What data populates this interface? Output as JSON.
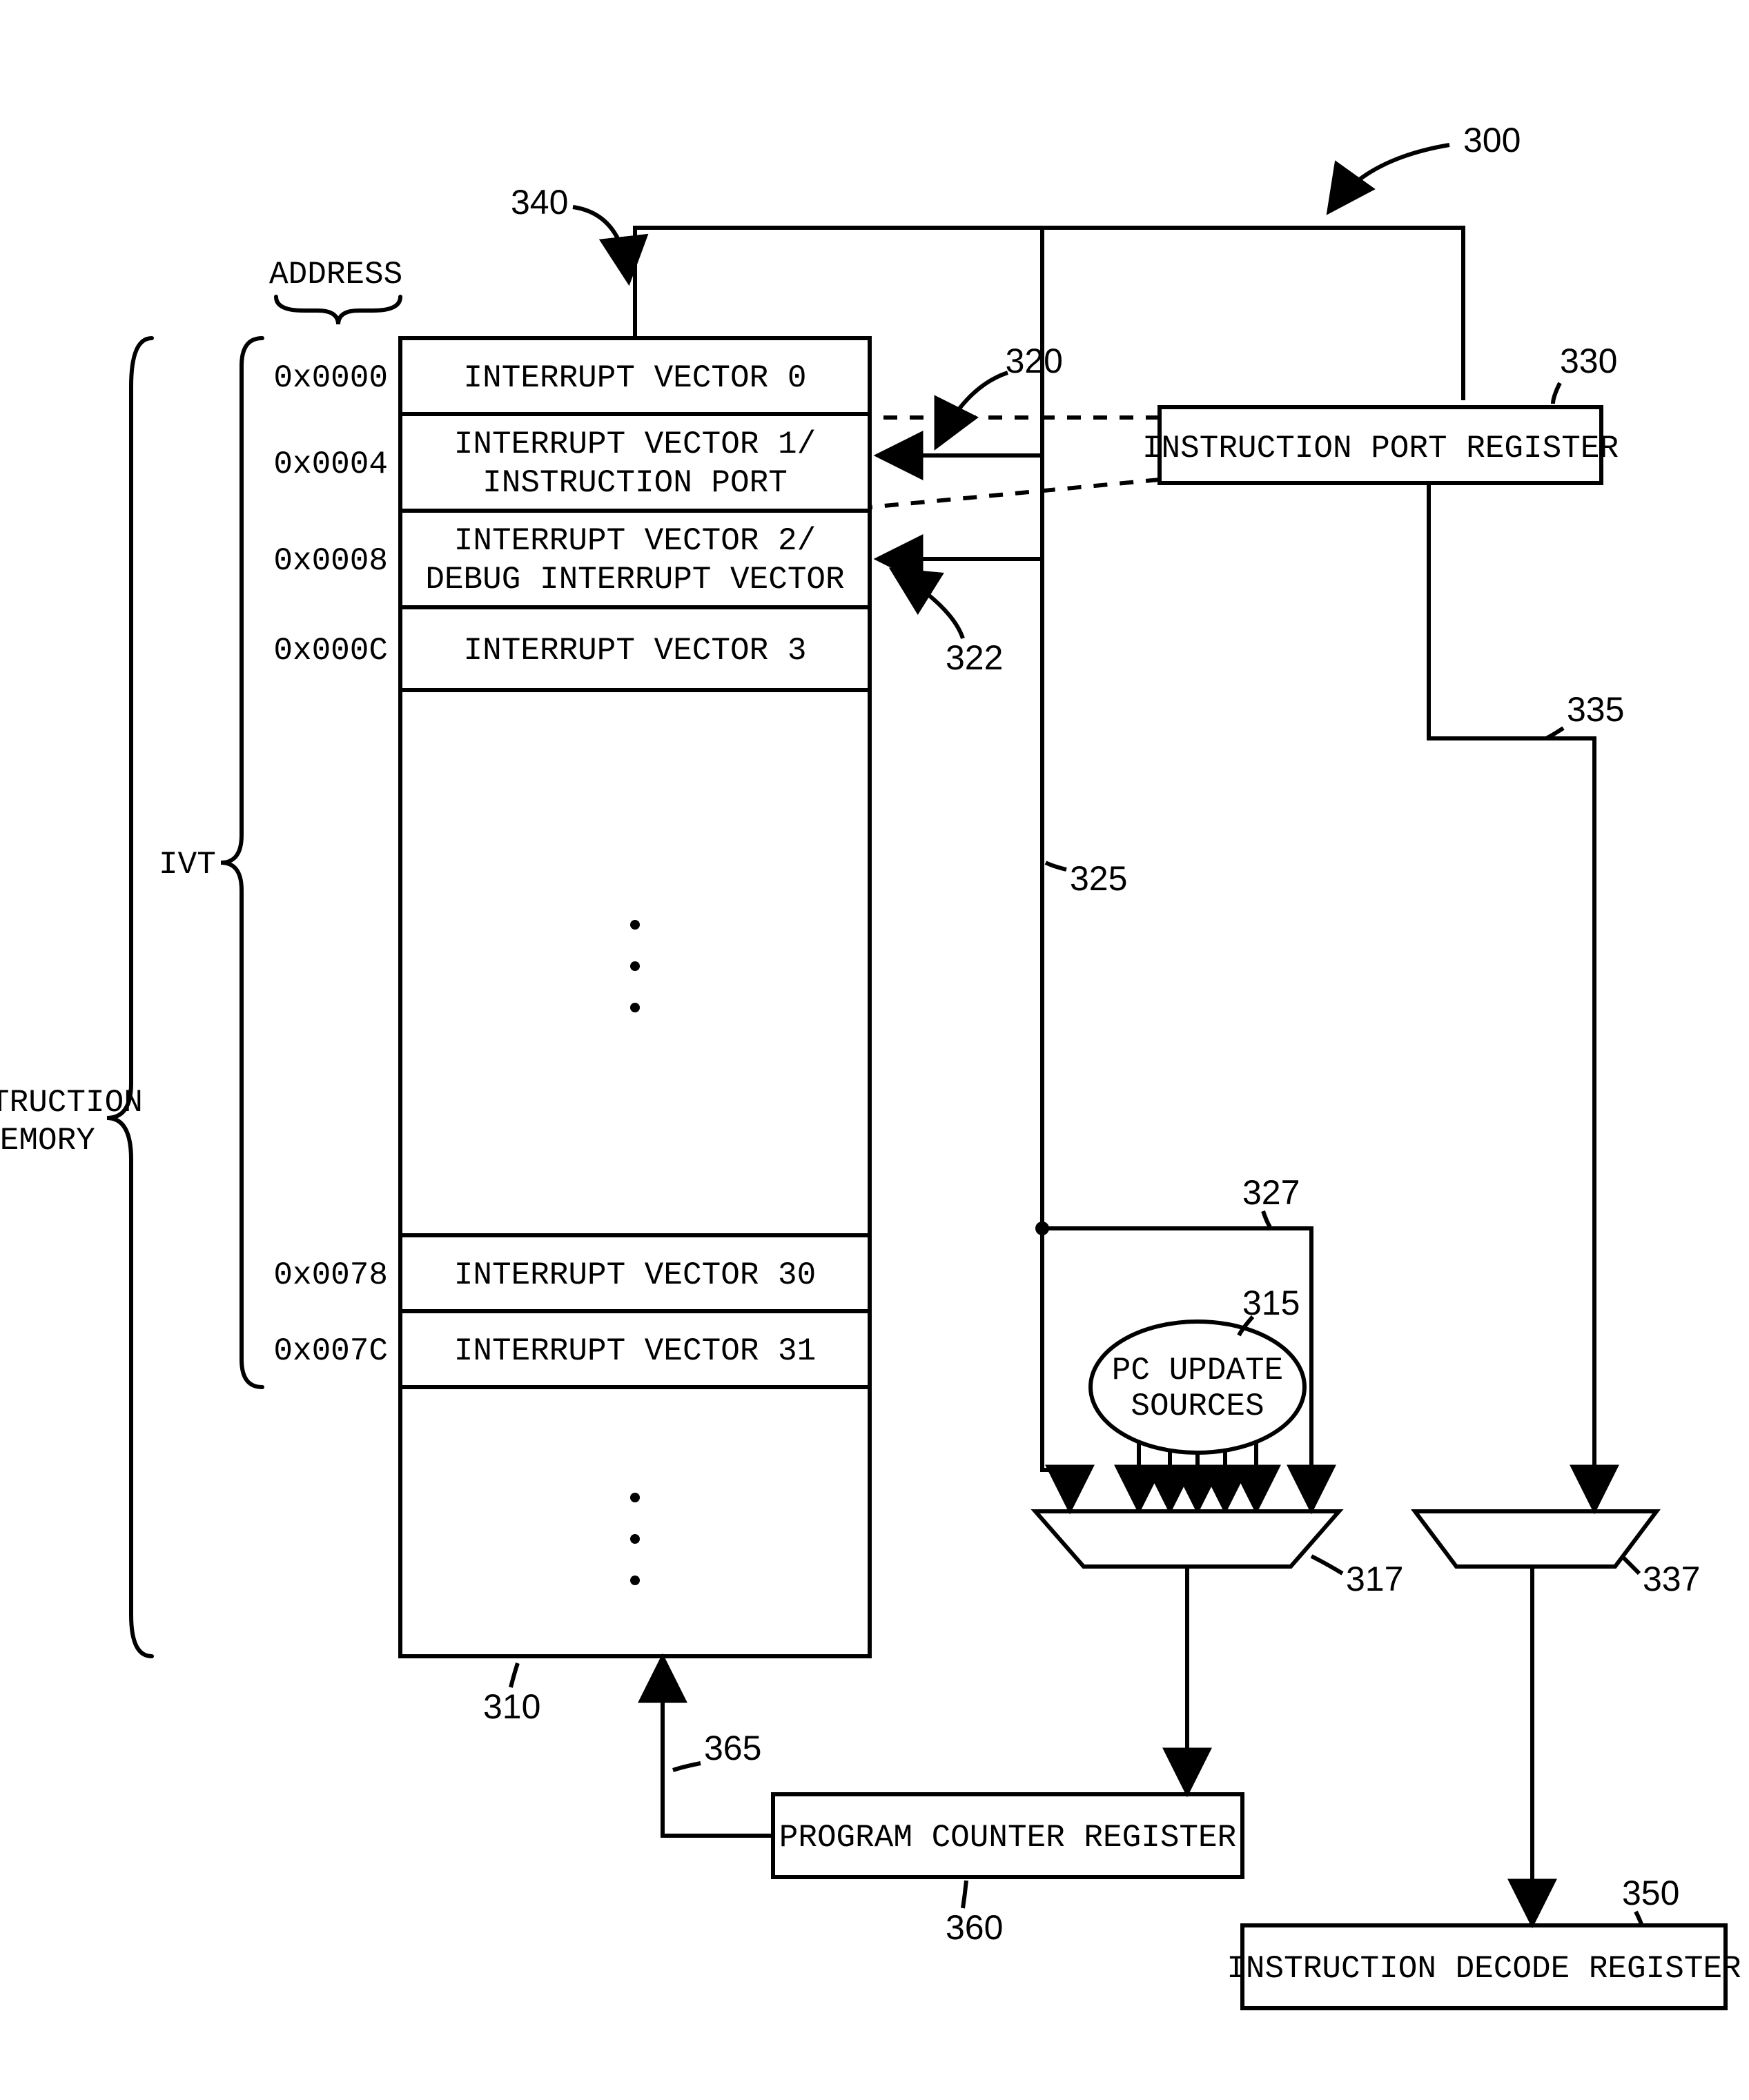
{
  "diagram_number": "300",
  "section_labels": {
    "address": "ADDRESS",
    "ivt": "IVT",
    "instruction_memory": "INSTRUCTION\nMEMORY"
  },
  "memory_table": {
    "addresses": [
      "0x0000",
      "0x0004",
      "0x0008",
      "0x000C",
      "0x0078",
      "0x007C"
    ],
    "rows": [
      {
        "addr_idx": 0,
        "lines": [
          "INTERRUPT VECTOR 0"
        ]
      },
      {
        "addr_idx": 1,
        "lines": [
          "INTERRUPT VECTOR 1/",
          "INSTRUCTION PORT"
        ]
      },
      {
        "addr_idx": 2,
        "lines": [
          "INTERRUPT VECTOR 2/",
          "DEBUG INTERRUPT VECTOR"
        ]
      },
      {
        "addr_idx": 3,
        "lines": [
          "INTERRUPT VECTOR 3"
        ]
      },
      {
        "addr_idx": 4,
        "lines": [
          "INTERRUPT VECTOR 30"
        ]
      },
      {
        "addr_idx": 5,
        "lines": [
          "INTERRUPT VECTOR 31"
        ]
      }
    ]
  },
  "blocks": {
    "instruction_port_register": "INSTRUCTION PORT REGISTER",
    "pc_update_sources": "PC UPDATE\nSOURCES",
    "program_counter_register": "PROGRAM COUNTER REGISTER",
    "instruction_decode_register": "INSTRUCTION DECODE REGISTER"
  },
  "callouts": {
    "c300": "300",
    "c340": "340",
    "c320": "320",
    "c322": "322",
    "c325": "325",
    "c330": "330",
    "c335": "335",
    "c327": "327",
    "c315": "315",
    "c317": "317",
    "c337": "337",
    "c310": "310",
    "c365": "365",
    "c360": "360",
    "c350": "350"
  }
}
